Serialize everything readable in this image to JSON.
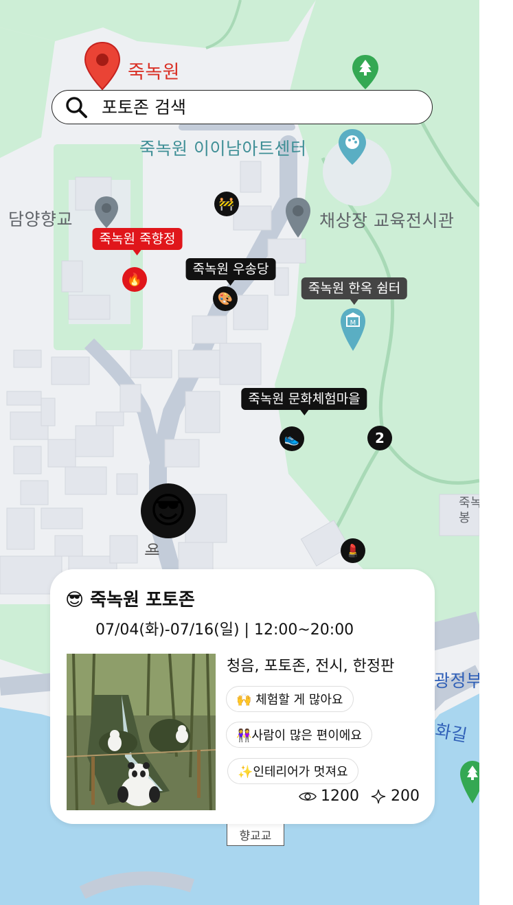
{
  "search": {
    "placeholder": "포토존 검색"
  },
  "map_labels": {
    "top_red": "죽녹원",
    "art_center": "죽녹원 이이남아트센터",
    "hyanggyo": "담양향교",
    "exhibition": "채상장 교육전시관",
    "hyanggyo_bridge": "향교교",
    "right_edge_1": "죽녹",
    "right_edge_2": "봉",
    "right_edge_3": "광정부",
    "right_edge_4": "화길"
  },
  "place_tags": {
    "jukhyang": "죽녹원 죽향정",
    "usong": "죽녹원 우송당",
    "hanok": "죽녹원 한옥 쉼터",
    "munhwa": "죽녹원 문화체험마을"
  },
  "markers": {
    "cluster_count": "2",
    "fire_icon": "fire-icon",
    "palette_icon": "palette-icon",
    "shoe_icon": "shoe-icon",
    "lipstick_icon": "lipstick-icon",
    "construction_icon": "construction-icon"
  },
  "avatar": {
    "emoji": "😎"
  },
  "card": {
    "emoji": "😎",
    "title": "죽녹원 포토존",
    "schedule": "07/04(화)-07/16(일) | 12:00~20:00",
    "tags": "청음, 포토존, 전시, 한정판",
    "chips": [
      "🙌 체험할 게 많아요",
      "👭사람이 많은 편이에요",
      "✨인테리어가 멋져요"
    ],
    "views": "1200",
    "likes": "200"
  },
  "colors": {
    "park_green": "#cdeed6",
    "water_blue": "#a9d6ef",
    "road": "#c3ccd9",
    "accent_red": "#e0161b",
    "teal_pin": "#5aaec3"
  }
}
